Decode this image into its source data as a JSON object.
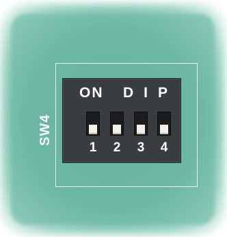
{
  "component": {
    "designator": "SW4",
    "type_label_on": "ON",
    "type_label_dip": "DIP",
    "switches": [
      {
        "number": "1",
        "state": "off"
      },
      {
        "number": "2",
        "state": "off"
      },
      {
        "number": "3",
        "state": "off"
      },
      {
        "number": "4",
        "state": "off"
      }
    ]
  },
  "colors": {
    "pcb": "#6db8a3",
    "silkscreen": "#f2fbf8",
    "switch_body": "#3a3d40",
    "lever": "#f3efe6"
  }
}
